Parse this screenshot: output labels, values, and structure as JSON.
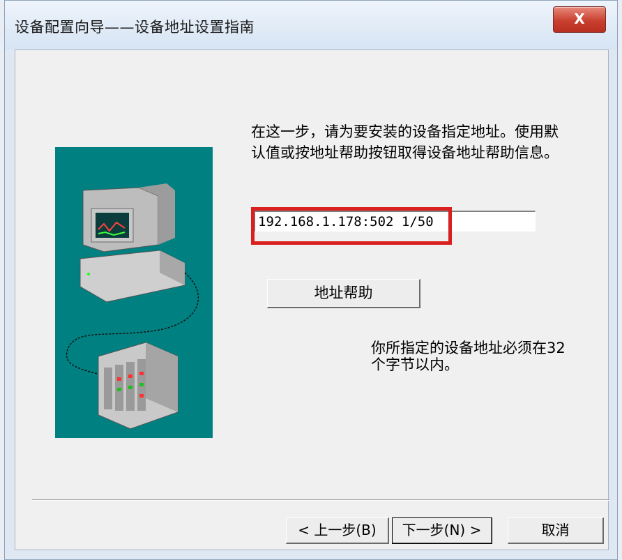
{
  "window": {
    "title": "设备配置向导——设备地址设置指南",
    "close_label": "X"
  },
  "main": {
    "description": "在这一步，请为要安装的设备指定地址。使用默认值或按地址帮助按钮取得设备地址帮助信息。",
    "address_value": "192.168.1.178:502 1/50",
    "help_button_label": "地址帮助",
    "note": "你所指定的设备地址必须在32个字节以内。"
  },
  "footer": {
    "prev_label": "< 上一步(B)",
    "next_label": "下一步(N) >",
    "cancel_label": "取消"
  },
  "colors": {
    "illustration_bg": "#008081",
    "highlight": "#d9201f"
  }
}
